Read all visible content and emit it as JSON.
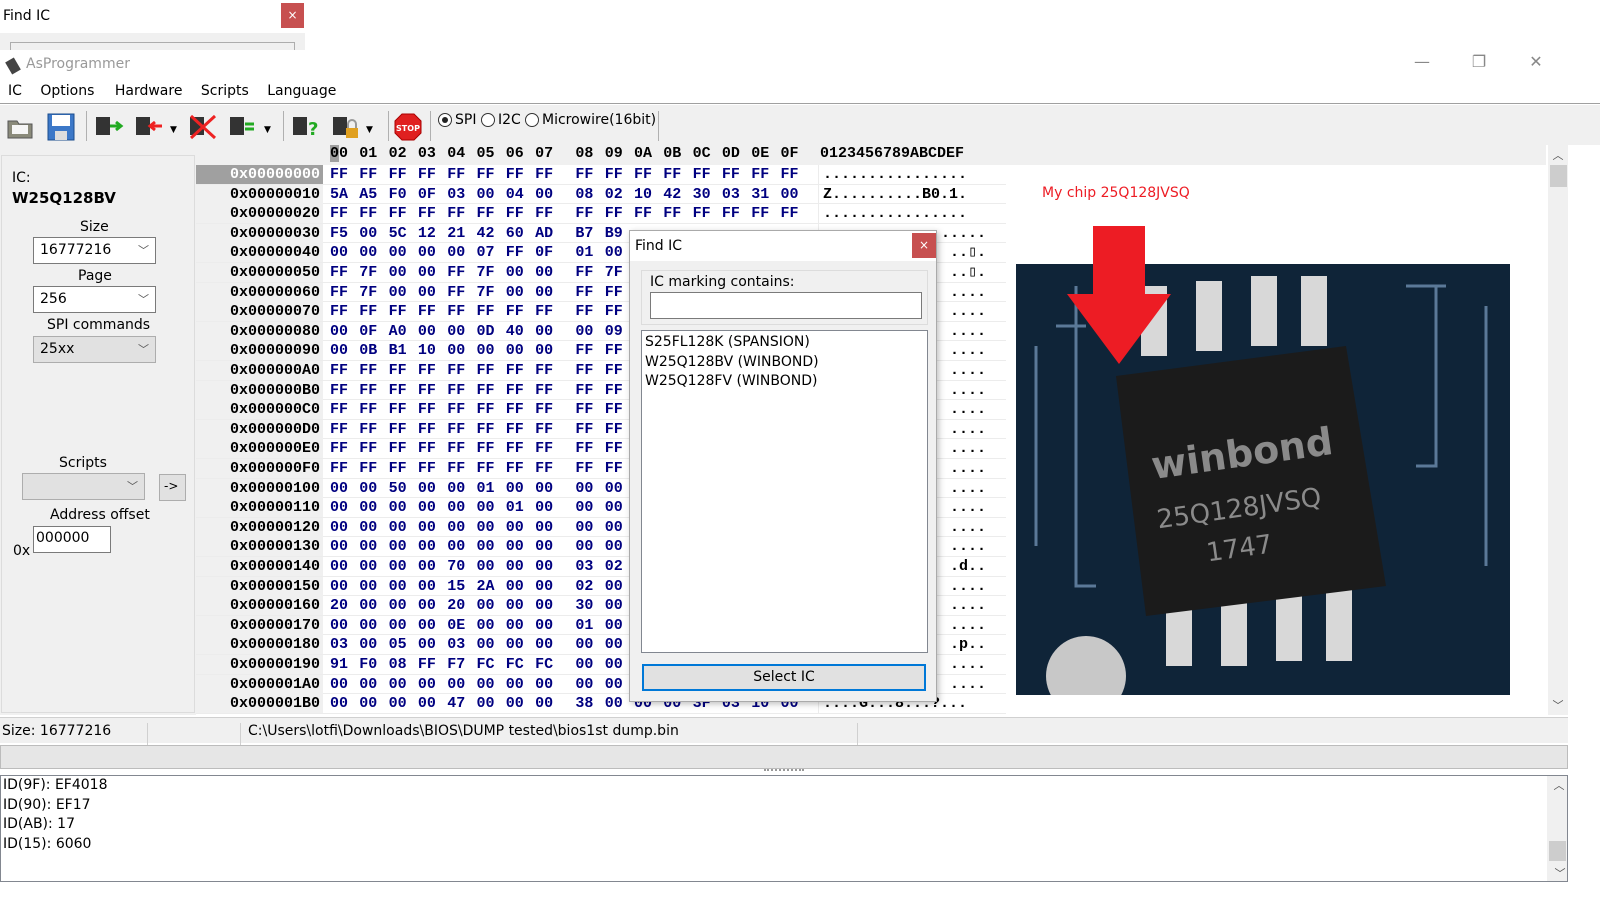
{
  "ghost_window": {
    "title": "Find IC",
    "close": "×"
  },
  "window": {
    "title": "AsProgrammer",
    "minimize": "—",
    "restore": "❐",
    "close": "✕"
  },
  "menu": [
    "IC",
    "Options",
    "Hardware",
    "Scripts",
    "Language"
  ],
  "toolbar": {
    "icons": [
      "open-icon",
      "save-icon",
      "read-icon",
      "write-icon",
      "erase-icon",
      "verify-icon",
      "check-icon",
      "protect-icon",
      "stop-icon"
    ],
    "stop_label": "STOP",
    "protocols": [
      {
        "label": "SPI",
        "selected": true
      },
      {
        "label": "I2C",
        "selected": false
      },
      {
        "label": "Microwire(16bit)",
        "selected": false
      }
    ]
  },
  "left": {
    "ic_label": "IC:",
    "ic_name": "W25Q128BV",
    "size_label": "Size",
    "size_value": "16777216",
    "page_label": "Page",
    "page_value": "256",
    "spi_label": "SPI commands",
    "spi_value": "25xx",
    "scripts_label": "Scripts",
    "scripts_value": "",
    "run_script": "->",
    "offset_label": "Address offset",
    "offset_prefix": "0x",
    "offset_value": "000000"
  },
  "hex": {
    "columns": [
      "00",
      "01",
      "02",
      "03",
      "04",
      "05",
      "06",
      "07",
      "08",
      "09",
      "0A",
      "0B",
      "0C",
      "0D",
      "0E",
      "0F"
    ],
    "ascii_header": "0123456789ABCDEF",
    "rows": [
      {
        "addr": "0x00000000",
        "bytes": "FF FF FF FF FF FF FF FF FF FF FF FF FF FF FF FF",
        "ascii": "................",
        "selected": true
      },
      {
        "addr": "0x00000010",
        "bytes": "5A A5 F0 0F 03 00 04 00 08 02 10 42 30 03 31 00",
        "ascii": "Z..........B0.1."
      },
      {
        "addr": "0x00000020",
        "bytes": "FF FF FF FF FF FF FF FF FF FF FF FF FF FF FF FF",
        "ascii": "................"
      },
      {
        "addr": "0x00000030",
        "bytes": "F5 00 5C 12 21 42 60 AD B7 B9",
        "ascii_tail": "....."
      },
      {
        "addr": "0x00000040",
        "bytes": "00 00 00 00 00 07 FF 0F 01 00",
        "ascii_tail": "..▯."
      },
      {
        "addr": "0x00000050",
        "bytes": "FF 7F 00 00 FF 7F 00 00 FF 7F",
        "ascii_tail": "..▯."
      },
      {
        "addr": "0x00000060",
        "bytes": "FF 7F 00 00 FF 7F 00 00 FF FF",
        "ascii_tail": "...."
      },
      {
        "addr": "0x00000070",
        "bytes": "FF FF FF FF FF FF FF FF FF FF",
        "ascii_tail": "...."
      },
      {
        "addr": "0x00000080",
        "bytes": "00 0F A0 00 00 0D 40 00 00 09",
        "ascii_tail": "...."
      },
      {
        "addr": "0x00000090",
        "bytes": "00 0B B1 10 00 00 00 00 FF FF",
        "ascii_tail": "...."
      },
      {
        "addr": "0x000000A0",
        "bytes": "FF FF FF FF FF FF FF FF FF FF",
        "ascii_tail": "...."
      },
      {
        "addr": "0x000000B0",
        "bytes": "FF FF FF FF FF FF FF FF FF FF",
        "ascii_tail": "...."
      },
      {
        "addr": "0x000000C0",
        "bytes": "FF FF FF FF FF FF FF FF FF FF",
        "ascii_tail": "...."
      },
      {
        "addr": "0x000000D0",
        "bytes": "FF FF FF FF FF FF FF FF FF FF",
        "ascii_tail": "...."
      },
      {
        "addr": "0x000000E0",
        "bytes": "FF FF FF FF FF FF FF FF FF FF",
        "ascii_tail": "...."
      },
      {
        "addr": "0x000000F0",
        "bytes": "FF FF FF FF FF FF FF FF FF FF",
        "ascii_tail": "...."
      },
      {
        "addr": "0x00000100",
        "bytes": "00 00 50 00 00 01 00 00 00 00",
        "ascii_tail": "...."
      },
      {
        "addr": "0x00000110",
        "bytes": "00 00 00 00 00 00 01 00 00 00",
        "ascii_tail": "...."
      },
      {
        "addr": "0x00000120",
        "bytes": "00 00 00 00 00 00 00 00 00 00",
        "ascii_tail": "...."
      },
      {
        "addr": "0x00000130",
        "bytes": "00 00 00 00 00 00 00 00 00 00",
        "ascii_tail": "...."
      },
      {
        "addr": "0x00000140",
        "bytes": "00 00 00 00 70 00 00 00 03 02",
        "ascii_tail": ".d.."
      },
      {
        "addr": "0x00000150",
        "bytes": "00 00 00 00 15 2A 00 00 02 00",
        "ascii_tail": "...."
      },
      {
        "addr": "0x00000160",
        "bytes": "20 00 00 00 20 00 00 00 30 00",
        "ascii_tail": "...."
      },
      {
        "addr": "0x00000170",
        "bytes": "00 00 00 00 0E 00 00 00 01 00",
        "ascii_tail": "...."
      },
      {
        "addr": "0x00000180",
        "bytes": "03 00 05 00 03 00 00 00 00 00",
        "ascii_tail": ".p.."
      },
      {
        "addr": "0x00000190",
        "bytes": "91 F0 08 FF F7 FC FC FC 00 00",
        "ascii_tail": "...."
      },
      {
        "addr": "0x000001A0",
        "bytes": "00 00 00 00 00 00 00 00 00 00",
        "ascii_tail": "...."
      },
      {
        "addr": "0x000001B0",
        "bytes": "00 00 00 00 47 00 00 00 38 00 00 00 3F 03 10 00",
        "ascii": "....G...8...?..."
      }
    ]
  },
  "annotation": {
    "text": "My chip 25Q128JVSQ",
    "color": "#ed1c24",
    "chip_marking": [
      "winbond",
      "25Q128JVSQ",
      "1747"
    ]
  },
  "status": {
    "size": "Size: 16777216",
    "path": "C:\\Users\\lotfi\\Downloads\\BIOS\\DUMP tested\\bios1st dump.bin"
  },
  "progress": 0,
  "log": [
    "ID(9F): EF4018",
    "ID(90): EF17",
    "ID(AB): 17",
    "ID(15): 6060"
  ],
  "find_dialog": {
    "title": "Find IC",
    "close": "×",
    "filter_label": "IC marking contains:",
    "filter_value": "",
    "results": [
      "S25FL128K (SPANSION)",
      "W25Q128BV (WINBOND)",
      "W25Q128FV (WINBOND)"
    ],
    "select_button": "Select IC"
  }
}
